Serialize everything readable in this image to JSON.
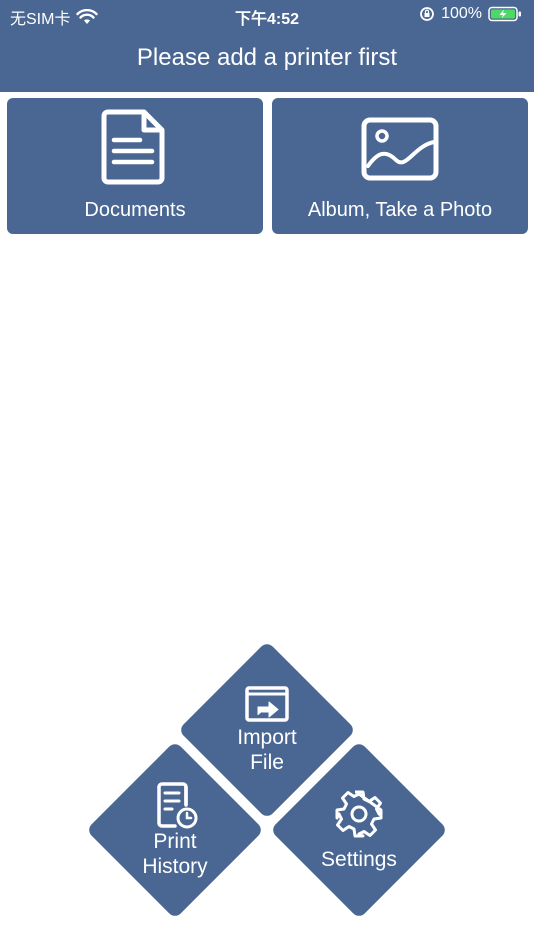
{
  "status_bar": {
    "carrier": "无SIM卡",
    "time": "下午4:52",
    "battery": "100%"
  },
  "header": {
    "title": "Please add a printer first"
  },
  "tiles": {
    "documents": {
      "label": "Documents",
      "icon": "document-icon"
    },
    "album": {
      "label": "Album, Take a Photo",
      "icon": "image-icon"
    }
  },
  "actions": {
    "import": {
      "line1": "Import",
      "line2": "File",
      "icon": "import-file-icon"
    },
    "history": {
      "line1": "Print",
      "line2": "History",
      "icon": "print-history-icon"
    },
    "settings": {
      "label": "Settings",
      "icon": "gear-icon"
    }
  },
  "colors": {
    "primary": "#4a6793",
    "background": "#ffffff",
    "text_on_primary": "#ffffff"
  }
}
